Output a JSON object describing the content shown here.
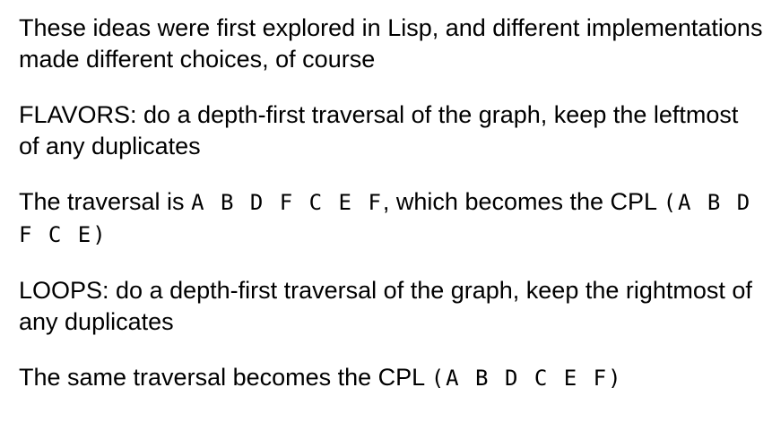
{
  "paragraphs": {
    "p1": "These ideas were first explored in Lisp, and different implementations made different choices, of course",
    "p2": "FLAVORS: do a depth-first traversal of the graph, keep the leftmost of any duplicates",
    "p3_prefix": "The traversal is ",
    "p3_traversal": "A B D F C E F",
    "p3_middle": ", which becomes the CPL ",
    "p3_cpl": "(A B D F C E)",
    "p4": "LOOPS: do a depth-first traversal of the graph, keep the rightmost of any duplicates",
    "p5_prefix": "The same traversal becomes the CPL ",
    "p5_cpl": "(A B D C E F)"
  }
}
